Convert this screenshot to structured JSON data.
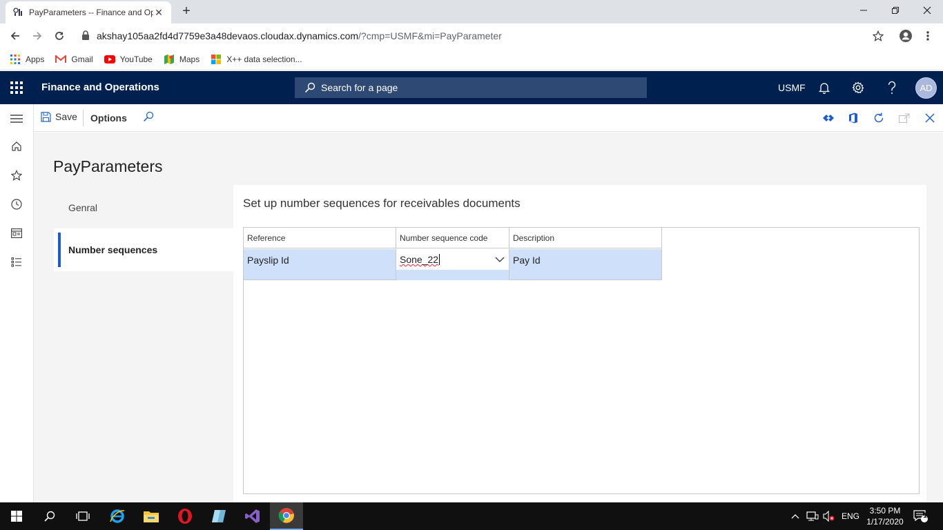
{
  "browser": {
    "tab_title": "PayParameters -- Finance and Operations",
    "url_host": "akshay105aa2fd4d7759e3a48devaos.cloudax.dynamics.com",
    "url_path": "/?cmp=USMF&mi=PayParameter",
    "bookmarks": [
      {
        "label": "Apps",
        "icon": "apps-grid-icon"
      },
      {
        "label": "Gmail",
        "icon": "gmail-icon"
      },
      {
        "label": "YouTube",
        "icon": "youtube-icon"
      },
      {
        "label": "Maps",
        "icon": "maps-icon"
      },
      {
        "label": "X++ data selection...",
        "icon": "microsoft-icon"
      }
    ]
  },
  "appbar": {
    "title": "Finance and Operations",
    "search_placeholder": "Search for a page",
    "company": "USMF",
    "avatar_initials": "AD",
    "color": "#002050"
  },
  "actionpane": {
    "save_label": "Save",
    "options_label": "Options"
  },
  "page": {
    "title": "PayParameters",
    "tabs": [
      {
        "label": "Genral",
        "active": false
      },
      {
        "label": "Number sequences",
        "active": true
      }
    ],
    "section_title": "Set up number sequences for receivables documents",
    "grid": {
      "columns": [
        "Reference",
        "Number sequence code",
        "Description"
      ],
      "rows": [
        {
          "reference": "Payslip Id",
          "number_sequence_code": "Sone_22",
          "description": "Pay Id"
        }
      ]
    }
  },
  "taskbar": {
    "language": "ENG",
    "time": "3:50 PM",
    "date": "1/17/2020",
    "notification_count": "1"
  },
  "colors": {
    "accent": "#1c5bd0",
    "selected_row": "#cfe0fb"
  }
}
